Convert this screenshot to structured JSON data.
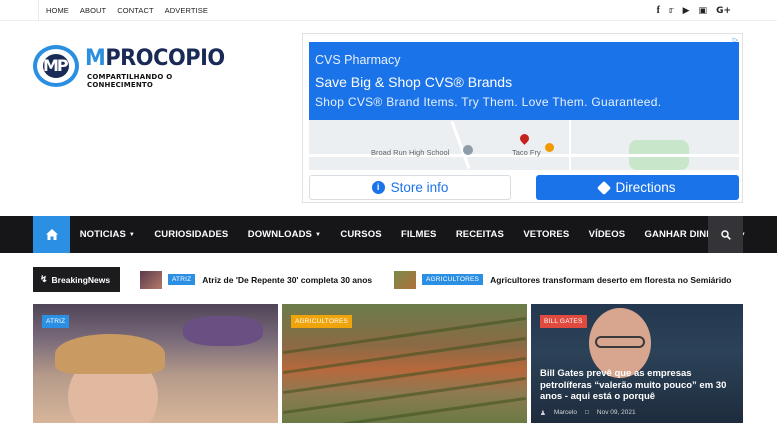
{
  "topbar": {
    "links": [
      "HOME",
      "ABOUT",
      "CONTACT",
      "ADVERTISE"
    ],
    "social_icons": [
      "facebook-icon",
      "twitter-icon",
      "youtube-icon",
      "instagram-icon",
      "google-plus-icon"
    ]
  },
  "logo": {
    "badge": "MP",
    "title_first": "M",
    "title_rest": "PROCOPIO",
    "tagline": "COMPARTILHANDO O CONHECIMENTO"
  },
  "ad": {
    "brand": "CVS Pharmacy",
    "headline": "Save Big & Shop CVS® Brands",
    "description": "Shop CVS® Brand Items. Try Them. Love Them. Guaranteed.",
    "map_label_school": "Broad Run High School",
    "map_label_place": "Taco Fry",
    "store_button": "Store info",
    "directions_button": "Directions",
    "accent": "#1a73e8"
  },
  "nav": {
    "items": [
      {
        "label": "NOTICIAS",
        "dropdown": true
      },
      {
        "label": "CURIOSIDADES",
        "dropdown": false
      },
      {
        "label": "DOWNLOADS",
        "dropdown": true
      },
      {
        "label": "CURSOS",
        "dropdown": false
      },
      {
        "label": "FILMES",
        "dropdown": false
      },
      {
        "label": "RECEITAS",
        "dropdown": false
      },
      {
        "label": "VETORES",
        "dropdown": false
      },
      {
        "label": "VÍDEOS",
        "dropdown": false
      },
      {
        "label": "GANHAR DINHEIRO",
        "dropdown": true
      }
    ],
    "caret": "▼",
    "accent": "#2b8fe3"
  },
  "ticker": {
    "label": "BreakingNews",
    "items": [
      {
        "badge": "ATRIZ",
        "text": "Atriz de 'De Repente 30' completa 30 anos"
      },
      {
        "badge": "AGRICULTORES",
        "text": "Agricultores transformam deserto em floresta no Semiárido"
      }
    ]
  },
  "cards": [
    {
      "badge": "ATRIZ"
    },
    {
      "badge": "AGRICULTORES"
    },
    {
      "badge": "BILL GATES",
      "title": "Bill Gates prevê que as empresas petrolíferas “valerão muito pouco” em 30 anos - aqui está o porquê",
      "author": "Marcelo",
      "date": "Nov 09, 2021"
    }
  ]
}
